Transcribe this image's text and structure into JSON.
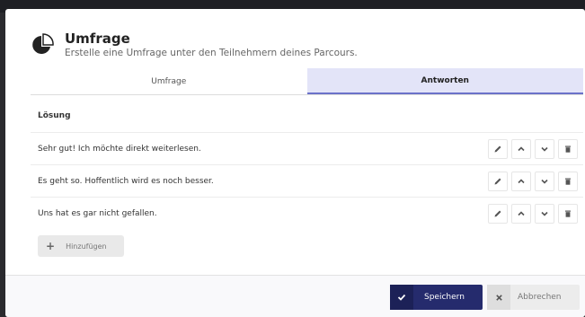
{
  "header": {
    "title": "Umfrage",
    "subtitle": "Erstelle eine Umfrage unter den Teilnehmern deines Parcours."
  },
  "tabs": [
    {
      "label": "Umfrage",
      "active": false
    },
    {
      "label": "Antworten",
      "active": true
    }
  ],
  "section_label": "Lösung",
  "answers": [
    "Sehr gut! Ich möchte direkt weiterlesen.",
    "Es geht so. Hoffentlich wird es noch besser.",
    "Uns hat es gar nicht gefallen."
  ],
  "add_label": "Hinzufügen",
  "footer": {
    "save_label": "Speichern",
    "cancel_label": "Abbrechen"
  },
  "colors": {
    "accent": "#252b6d",
    "tab_active_bg": "#e3e4f8"
  }
}
